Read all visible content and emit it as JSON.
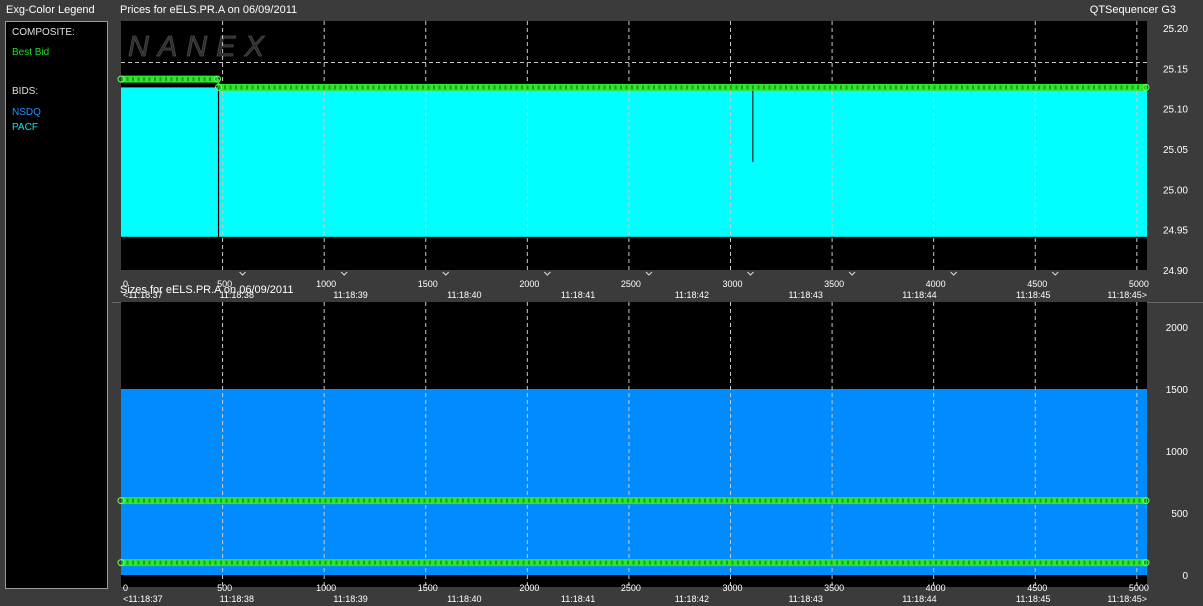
{
  "legend": {
    "title": "Exg-Color Legend",
    "composite_heading": "COMPOSITE:",
    "composite_items": [
      {
        "label": "Best Bid",
        "color": "#22dd22"
      }
    ],
    "bids_heading": "BIDS:",
    "bid_items": [
      {
        "label": "NSDQ",
        "color": "#2a8fff"
      },
      {
        "label": "PACF",
        "color": "#00ffff"
      }
    ]
  },
  "app_name": "QTSequencer G3",
  "watermark": "NANEX",
  "colors": {
    "best_bid": "#2ee62e",
    "nsdq": "#008cff",
    "pacf": "#00ffff",
    "grid": "#c8c8c8"
  },
  "chart_data": [
    {
      "type": "area",
      "title": "Prices for  eELS.PR.A  on  06/09/2011",
      "x_ticks": [
        0,
        500,
        1000,
        1500,
        2000,
        2500,
        3000,
        3500,
        4000,
        4500,
        5000
      ],
      "time_labels": [
        "<11:18:37",
        "11:18:38",
        "11:18:39",
        "11:18:40",
        "11:18:41",
        "11:18:42",
        "11:18:43",
        "11:18:44",
        "11:18:45",
        "11:18:45>"
      ],
      "xlim": [
        0,
        5050
      ],
      "ylim": [
        24.9,
        25.2
      ],
      "y_ticks": [
        "25.20",
        "25.15",
        "25.10",
        "25.05",
        "25.00",
        "24.95",
        "24.90"
      ],
      "reference_line": 25.15,
      "grid": true,
      "series": [
        {
          "name": "PACF",
          "x_start": 0,
          "x_end": 5050,
          "low": 24.94,
          "high": 25.12
        },
        {
          "name": "Best Bid",
          "points": [
            [
              0,
              25.13
            ],
            [
              480,
              25.13
            ],
            [
              480,
              25.12
            ],
            [
              5050,
              25.12
            ]
          ]
        }
      ]
    },
    {
      "type": "area",
      "title": "Sizes for  eELS.PR.A  on  06/09/2011",
      "x_ticks": [
        0,
        500,
        1000,
        1500,
        2000,
        2500,
        3000,
        3500,
        4000,
        4500,
        5000
      ],
      "time_labels": [
        "<11:18:37",
        "11:18:38",
        "11:18:39",
        "11:18:40",
        "11:18:41",
        "11:18:42",
        "11:18:43",
        "11:18:44",
        "11:18:45",
        "11:18:45>"
      ],
      "xlim": [
        0,
        5050
      ],
      "ylim": [
        0,
        2000
      ],
      "y_ticks": [
        "2000",
        "1500",
        "1000",
        "500",
        "0"
      ],
      "grid": true,
      "series": [
        {
          "name": "NSDQ",
          "x_start": 0,
          "x_end": 5050,
          "value": 1500
        },
        {
          "name": "Best Bid",
          "level_a": 600,
          "level_b": 100
        }
      ]
    }
  ]
}
